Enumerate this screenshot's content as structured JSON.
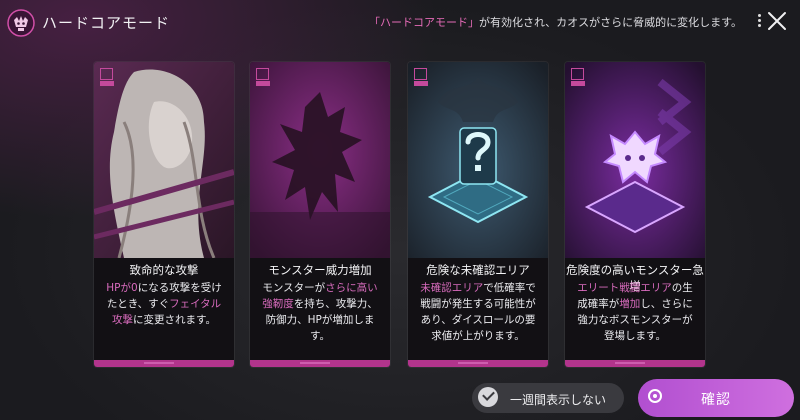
{
  "header": {
    "title": "ハードコアモード",
    "notice_hl": "「ハードコアモード」",
    "notice_rest": "が有効化され、カオスがさらに脅威的に変化します。"
  },
  "cards": [
    {
      "title": "致命的な攻撃",
      "body": [
        {
          "t": "HPが0",
          "h": true
        },
        {
          "t": "になる攻撃を受けたとき、すぐ",
          "h": false
        },
        {
          "t": "フェイタル攻撃",
          "h": true
        },
        {
          "t": "に変更されます。",
          "h": false
        }
      ]
    },
    {
      "title": "モンスター威力増加",
      "body": [
        {
          "t": "モンスターが",
          "h": false
        },
        {
          "t": "さらに高い強靭度",
          "h": true
        },
        {
          "t": "を持ち、攻撃力、防御力、HPが増加します。",
          "h": false
        }
      ]
    },
    {
      "title": "危険な未確認エリア",
      "body": [
        {
          "t": "未確認エリア",
          "h": true
        },
        {
          "t": "で低確率で戦闘が発生する可能性があり、ダイスロールの要求値が上がります。",
          "h": false
        }
      ]
    },
    {
      "title": "危険度の高いモンスター急増",
      "body": [
        {
          "t": "エリート戦闘エリア",
          "h": true
        },
        {
          "t": "の生成確率が",
          "h": false
        },
        {
          "t": "増加",
          "h": true
        },
        {
          "t": "し、さらに強力なボスモンスターが登場します。",
          "h": false
        }
      ]
    }
  ],
  "footer": {
    "skip_label": "一週間表示しない",
    "confirm_label": "確認"
  },
  "colors": {
    "accent": "#b2348c",
    "highlight": "#d86bbd",
    "confirm": "#c060d8"
  }
}
